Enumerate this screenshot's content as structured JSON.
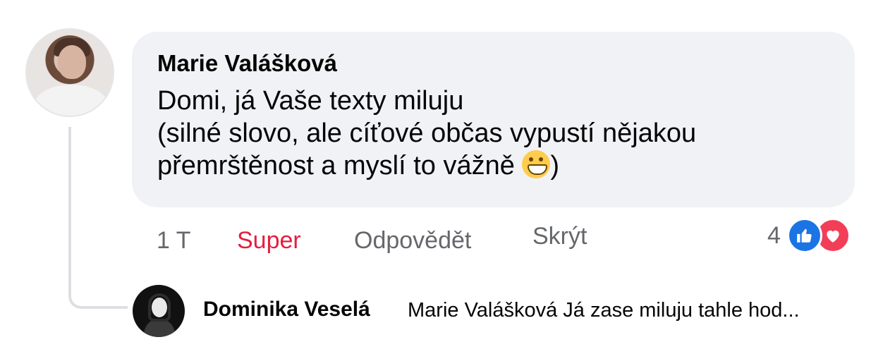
{
  "comment": {
    "author": "Marie Valášková",
    "text_lines": [
      "Domi, já Vaše texty miluju",
      "(silné slovo, ale cíťové občas vypustí nějakou",
      "přemrštěnost a myslí to vážně"
    ],
    "text_suffix": ")",
    "emoji": "grinning-face-with-big-eyes"
  },
  "actions": {
    "time": "1 T",
    "reaction_label": "Super",
    "reply_label": "Odpovědět",
    "hide_label": "Skrýt"
  },
  "reactions": {
    "count": "4",
    "types": [
      "like",
      "love"
    ],
    "colors": {
      "like": "#1b74e4",
      "love": "#f33e58"
    }
  },
  "reply": {
    "author": "Dominika Veselá",
    "preview": "Marie Valášková Já zase miluju tahle hod..."
  },
  "colors": {
    "bubble": "#f0f2f5",
    "accent_reaction": "#e41e3f",
    "secondary_text": "#65676b"
  }
}
